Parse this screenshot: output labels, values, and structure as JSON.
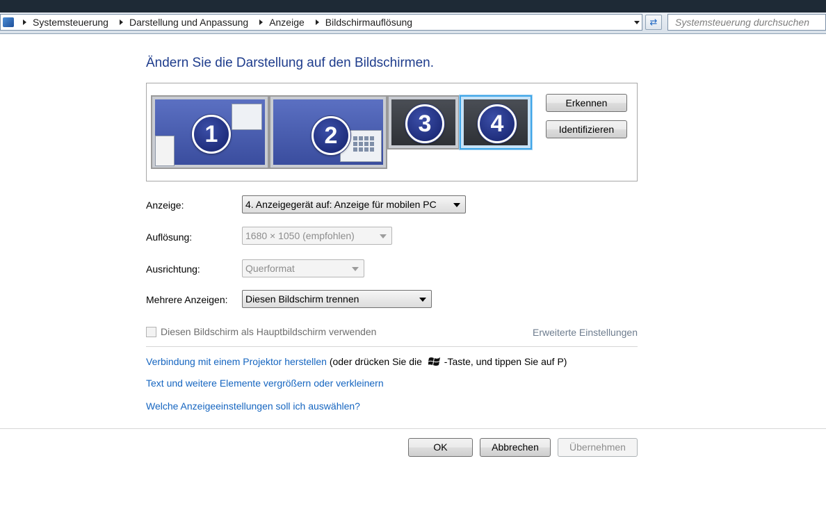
{
  "address_bar": {
    "breadcrumbs": [
      "Systemsteuerung",
      "Darstellung und Anpassung",
      "Anzeige",
      "Bildschirmauflösung"
    ],
    "search_placeholder": "Systemsteuerung durchsuchen"
  },
  "page": {
    "title": "Ändern Sie die Darstellung auf den Bildschirmen."
  },
  "monitors": [
    {
      "number": "1",
      "selected": false
    },
    {
      "number": "2",
      "selected": false
    },
    {
      "number": "3",
      "selected": false
    },
    {
      "number": "4",
      "selected": true
    }
  ],
  "preview_buttons": {
    "detect": "Erkennen",
    "identify": "Identifizieren"
  },
  "settings": {
    "display_label": "Anzeige:",
    "display_value": "4. Anzeigegerät auf: Anzeige für mobilen PC",
    "resolution_label": "Auflösung:",
    "resolution_value": "1680 × 1050 (empfohlen)",
    "orientation_label": "Ausrichtung:",
    "orientation_value": "Querformat",
    "multiple_label": "Mehrere Anzeigen:",
    "multiple_value": "Diesen Bildschirm trennen"
  },
  "main_display_checkbox": {
    "label": "Diesen Bildschirm als Hauptbildschirm verwenden",
    "checked": false
  },
  "advanced_link": "Erweiterte Einstellungen",
  "links": {
    "projector": "Verbindung mit einem Projektor herstellen",
    "projector_hint_before": "(oder drücken Sie die",
    "projector_hint_after": "-Taste, und tippen Sie auf P)",
    "text_size": "Text und weitere Elemente vergrößern oder verkleinern",
    "which_settings": "Welche Anzeigeeinstellungen soll ich auswählen?"
  },
  "footer_buttons": {
    "ok": "OK",
    "cancel": "Abbrechen",
    "apply": "Übernehmen"
  },
  "colors": {
    "title": "#1e3c8c",
    "link": "#1565c0",
    "monitor_blue": "#4a5fb0",
    "monitor_dark": "#383c42",
    "selection": "#3fa6e8"
  }
}
